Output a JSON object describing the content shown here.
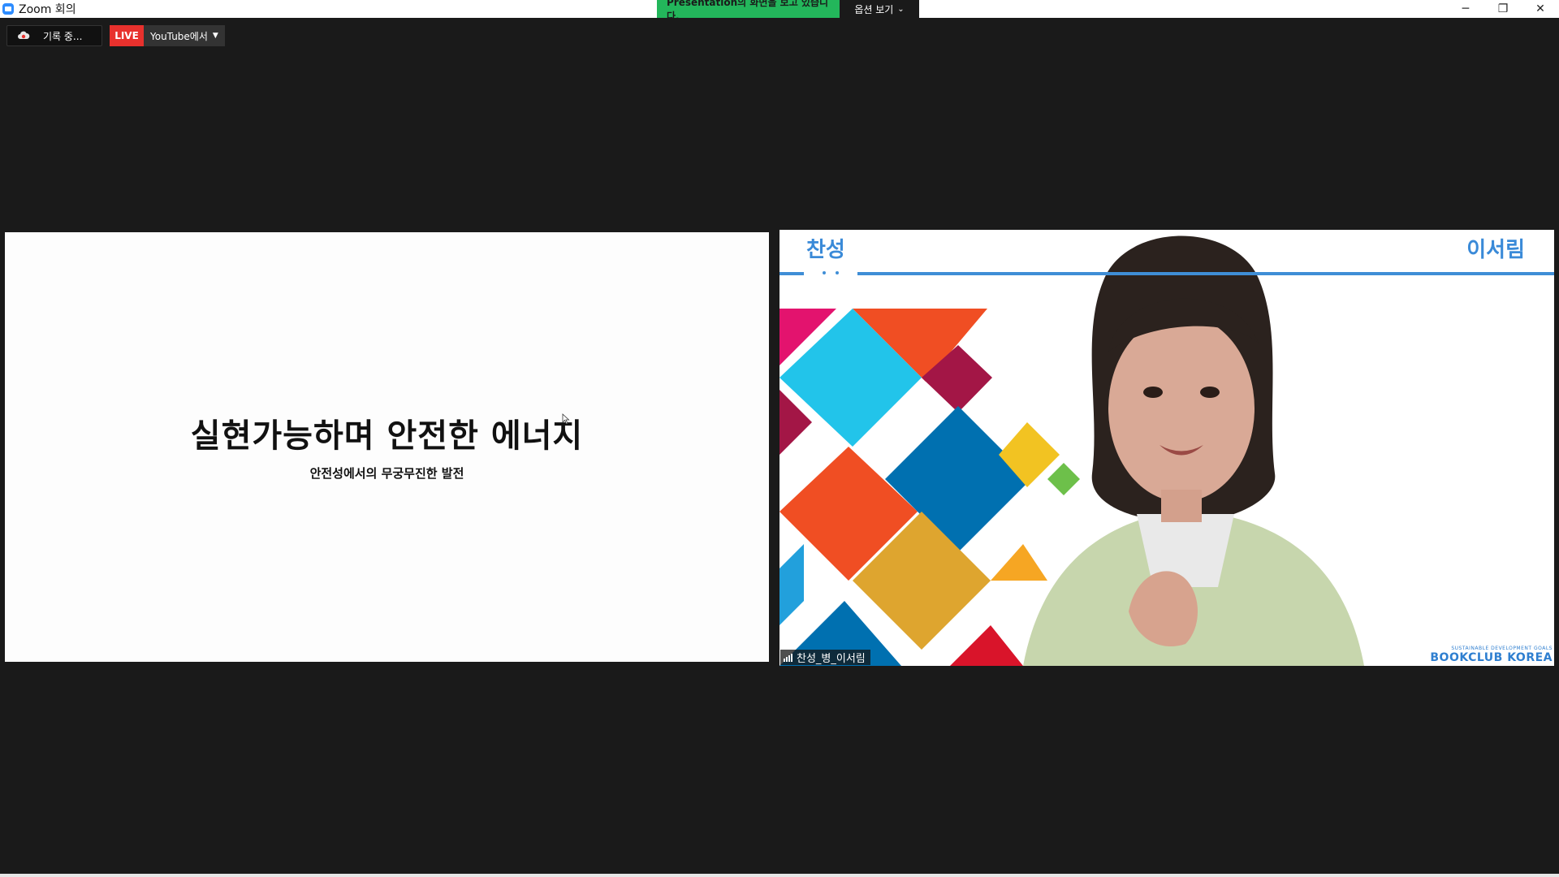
{
  "window": {
    "title": "Zoom 회의",
    "controls": {
      "minimize": "─",
      "restore": "❐",
      "close": "✕"
    }
  },
  "share_banner": {
    "message": "Presentation의 화면을 보고 있습니다.",
    "options_label": "옵션 보기",
    "options_chevron": "⌄",
    "color": "#23b65b"
  },
  "recording": {
    "icon": "cloud-record-icon",
    "label": "기록 중..."
  },
  "live": {
    "badge": "LIVE",
    "target": "YouTube에서",
    "caret": "▼",
    "color": "#e8312d"
  },
  "slide": {
    "headline": "실현가능하며 안전한 에너지",
    "subtitle": "안전성에서의 무궁무진한 발전"
  },
  "video": {
    "top_left": "찬성",
    "top_right": "이서림",
    "participant_name": "찬성_병_이서림",
    "logo_small": "SUSTAINABLE DEVELOPMENT GOALS",
    "logo_big": "BOOKCLUB KOREA"
  }
}
